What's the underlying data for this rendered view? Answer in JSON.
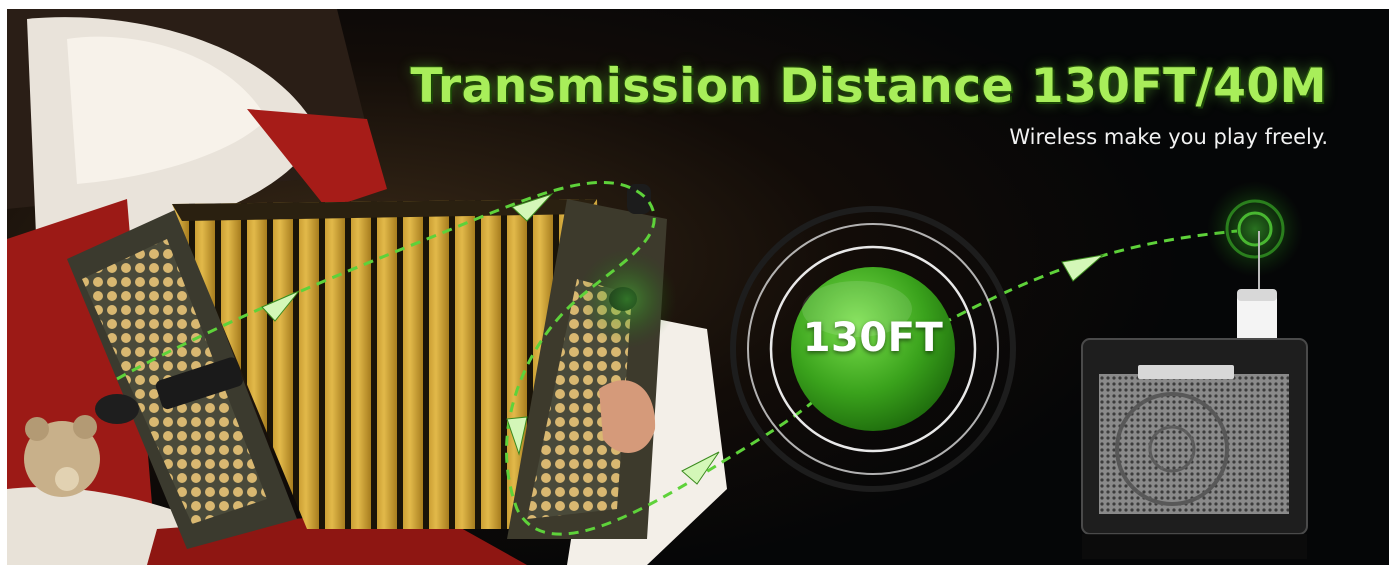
{
  "headline": "Transmission Distance 130FT/40M",
  "subline": "Wireless make you play freely.",
  "distance_badge": "130FT",
  "colors": {
    "accent_green": "#4fb52a",
    "headline_green": "#a8ee5a",
    "background": "#050607",
    "bellows_yellow": "#c9a13a"
  },
  "icons": [
    "paper-plane-icon",
    "signal-wave-icon"
  ]
}
